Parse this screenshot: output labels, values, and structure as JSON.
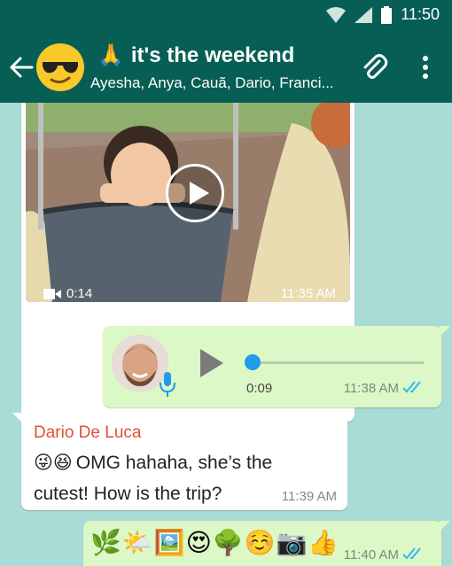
{
  "status": {
    "time": "11:50"
  },
  "header": {
    "group_emoji": "🙏",
    "title": "it's the weekend",
    "members": "Ayesha, Anya, Cauã, Dario, Franci..."
  },
  "messages": {
    "video": {
      "duration": "0:14",
      "time": "11:35 AM"
    },
    "voice": {
      "duration": "0:09",
      "time": "11:38 AM",
      "progress": 0
    },
    "text": {
      "sender": "Dario De Luca",
      "emojis": "😜😆",
      "line1": "OMG hahaha, she’s the",
      "line2": "cutest! How is the trip?",
      "time": "11:39 AM"
    },
    "emoji": {
      "content": "🌿🌤️🖼️😍🌳☺️📷👍",
      "time": "11:40 AM"
    }
  },
  "colors": {
    "header": "#075e54",
    "chat_bg": "#a9dcd6",
    "outgoing": "#dcf8c6",
    "read_ticks": "#34b7f1",
    "sender_name": "#e0502f"
  }
}
